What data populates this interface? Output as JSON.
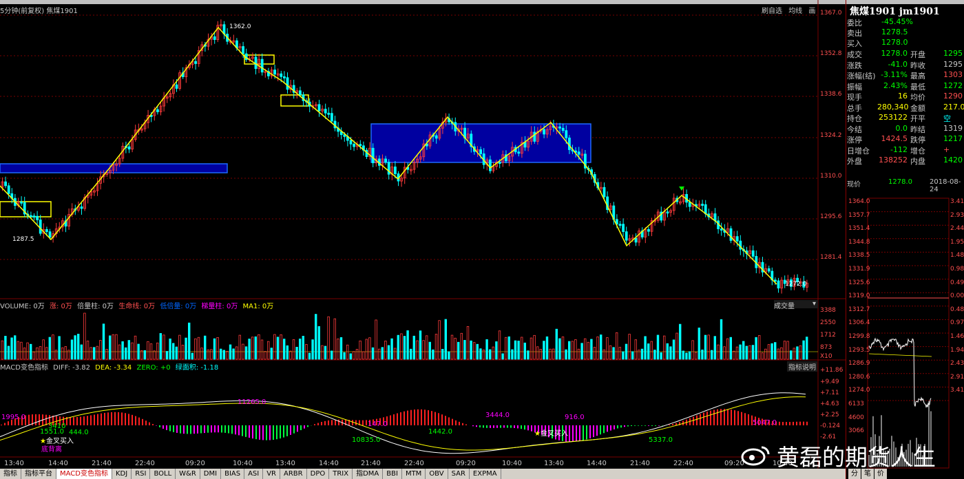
{
  "chart_header": {
    "period": "5分钟(前复权)",
    "symbol": "焦煤1901",
    "btn_1": "刷自选",
    "btn_2": "均线",
    "btn_3": "画"
  },
  "price_axis": [
    "1367.0",
    "1352.8",
    "1338.6",
    "1324.2",
    "1310.0",
    "1295.6",
    "1281.4"
  ],
  "price_annotations": {
    "high": "1362.0",
    "low_left": "1287.5",
    "low_right": "1272.0"
  },
  "volume_header": {
    "vol": "VOLUME: 0万",
    "zhang": "涨: 0万",
    "bei": "倍量柱: 0万",
    "shengming": "生命线: 0万",
    "dibei": "低倍量: 0万",
    "gaoliang": "梯量柱: 0万",
    "ma1": "MA1: 0万",
    "dropdown": "成交量"
  },
  "volume_axis": [
    "3388",
    "2550",
    "1712",
    "873",
    "X10"
  ],
  "macd_header": {
    "name": "MACD变色指标",
    "diff": "DIFF: -3.82",
    "dea": "DEA: -3.34",
    "zero": "ZERO: +0",
    "area": "绿面积: -1.18",
    "help": "指标说明"
  },
  "macd_axis": [
    "+11.86",
    "+9.49",
    "+7.11",
    "+4.63",
    "+2.25",
    "-0.124",
    "-2.61"
  ],
  "macd_annotations": {
    "a1": "1995.0",
    "a2": "1551.0",
    "a3": "444.0",
    "a4": "3410",
    "a5": "11265.0",
    "a6": "147.0",
    "a7": "10835.0",
    "a8": "1442.0",
    "a9": "3444.0",
    "a10": "916.0",
    "a11": "5337.0",
    "a12": "5047.0",
    "s1": "金叉买入",
    "s2": "底背离",
    "s3": "金叉买入"
  },
  "time_axis": [
    "13:40",
    "14:40",
    "21:40",
    "22:40",
    "09:20",
    "10:40",
    "13:40",
    "14:40",
    "21:40",
    "22:40",
    "09:20",
    "10:40",
    "13:40",
    "14:40",
    "21:40",
    "22:40",
    "09:20",
    "10:40"
  ],
  "tabs": [
    "指标",
    "指标平台",
    "MACD变色指标",
    "KDJ",
    "RSI",
    "BOLL",
    "W&R",
    "DMI",
    "BIAS",
    "ASI",
    "VR",
    "ARBR",
    "DPO",
    "TRIX",
    "指DMA",
    "BBI",
    "MTM",
    "OBV",
    "SAR",
    "EXPMA"
  ],
  "active_tab": "MACD变色指标",
  "contract": {
    "title": "焦煤1901 jm1901"
  },
  "quote": [
    {
      "l": "委比",
      "v": "-45.45%",
      "c": "#00ff00"
    },
    {
      "l": "卖出",
      "v": "1278.5",
      "c": "#00ff00"
    },
    {
      "l": "买入",
      "v": "1278.0",
      "c": "#00ff00"
    }
  ],
  "quote2": [
    {
      "l": "成交",
      "v": "1278.0",
      "c": "#00ff00",
      "l2": "开盘",
      "v2": "1295",
      "c2": "#00ff00"
    },
    {
      "l": "涨跌",
      "v": "-41.0",
      "c": "#00ff00",
      "l2": "昨收",
      "v2": "1295",
      "c2": "#c8c8c8"
    },
    {
      "l": "涨幅(结)",
      "v": "-3.11%",
      "c": "#00ff00",
      "l2": "最高",
      "v2": "1303",
      "c2": "#ff5050"
    },
    {
      "l": "振幅",
      "v": "2.43%",
      "c": "#00ff00",
      "l2": "最低",
      "v2": "1272",
      "c2": "#00ff00"
    },
    {
      "l": "现手",
      "v": "16",
      "c": "#ffff00",
      "l2": "均价",
      "v2": "1290",
      "c2": "#ff5050"
    },
    {
      "l": "总手",
      "v": "280,340",
      "c": "#ffff00",
      "l2": "金额",
      "v2": "217.0",
      "c2": "#ffff00"
    },
    {
      "l": "持仓",
      "v": "253122",
      "c": "#ffff00",
      "l2": "开平",
      "v2": "空",
      "c2": "#00ffff"
    },
    {
      "l": "今结",
      "v": "0.0",
      "c": "#00ff00",
      "l2": "昨结",
      "v2": "1319",
      "c2": "#c8c8c8"
    },
    {
      "l": "涨停",
      "v": "1424.5",
      "c": "#ff5050",
      "l2": "跌停",
      "v2": "1217",
      "c2": "#00ff00"
    },
    {
      "l": "日增仓",
      "v": "-112",
      "c": "#00ff00",
      "l2": "增仓",
      "v2": "+",
      "c2": "#ff5050"
    },
    {
      "l": "外盘",
      "v": "138252",
      "c": "#ff5050",
      "l2": "内盘",
      "v2": "1420",
      "c2": "#00ff00"
    }
  ],
  "price_row": {
    "label": "现价",
    "value": "1278.0",
    "date": "2018-08-24"
  },
  "mini_left_axis": [
    "1364.0",
    "1357.7",
    "1351.4",
    "1344.8",
    "1338.5",
    "1331.9",
    "1325.6",
    "1319.0",
    "1312.7",
    "1306.4",
    "1299.8",
    "1293.5",
    "1286.9",
    "1280.6",
    "1274.0",
    "6133",
    "4600",
    "3066"
  ],
  "mini_right_axis": [
    "3.41",
    "2.93",
    "2.44",
    "1.95",
    "1.48",
    "0.98",
    "0.49",
    "0.00",
    "0.48",
    "0.97",
    "1.46",
    "1.94",
    "2.43",
    "2.91",
    "3.41"
  ],
  "right_tabs": [
    "分",
    "笔",
    "价"
  ],
  "watermark": "黄磊的期货人生",
  "colors": {
    "up": "#ff3b3b",
    "down": "#00ffff",
    "zigzag": "#ffff00",
    "box_fill": "#0000a0",
    "box_stroke": "#1e6bff",
    "macd_up": "#ff2020",
    "macd_dn": "#00ff40",
    "macd_mag": "#ff00ff",
    "grid": "#7a0000"
  }
}
